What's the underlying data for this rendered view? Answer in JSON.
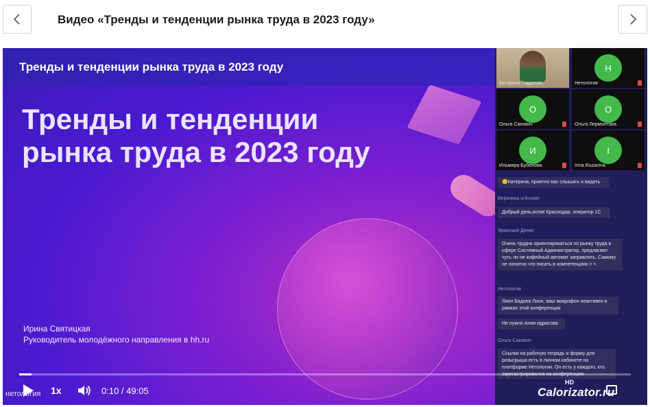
{
  "page": {
    "title": "Видео «Тренды и тенденции рынка труда в 2023 году»"
  },
  "video": {
    "slide_header": "Тренды и тенденции рынка труда в 2023 году",
    "slide_title_line1": "Тренды и тенденции",
    "slide_title_line2": "рынка труда в 2023 году",
    "presenter_name": "Ирина Святицкая",
    "presenter_role": "Руководитель молодёжного направления в hh.ru"
  },
  "participants": [
    {
      "name": "Катерина Гордеева",
      "avatar": ""
    },
    {
      "name": "Нетология",
      "avatar": "Н"
    },
    {
      "name": "Ольга Сакович",
      "avatar": "О"
    },
    {
      "name": "Ольга Лермонтова",
      "avatar": "О"
    },
    {
      "name": "Ильмира Бубенова",
      "avatar": "И"
    },
    {
      "name": "Irina Ruzavina",
      "avatar": "I"
    }
  ],
  "chat": [
    {
      "author": "",
      "text": "😊Катерина, приятно вас слышать и видеть"
    },
    {
      "author": "Вероника unknown",
      "text": "Добрый день,всем! Краснодар, оператор 1С"
    },
    {
      "author": "Яринский Денис",
      "text": "Очень трудно ориентироваться по рынку труда в сфере Системный Администратор, предлагают чуть ли не кофейный автомат заправлять. Самому не понятно что писать в компетенциях > <"
    },
    {
      "author": "Нетология",
      "text": "Лион Бадоев Лион, ваш микрофон неактивен в рамках этой конференции"
    },
    {
      "author": "",
      "text": "Не нужно Алия идрисова"
    },
    {
      "author": "Ольга Сакович",
      "text": "Ссылки на рабочую тетрадь и форму для розыгрыша есть в личном кабинете на платформе Нетологии. Он есть у каждого, кто зарегистрировался на конференцию"
    }
  ],
  "player": {
    "progress": 0.0034,
    "speed": "1x",
    "time": "0:10 / 49:05",
    "hd": "HD"
  },
  "watermarks": {
    "left": "нетология",
    "right": "Calorizator.ru"
  },
  "icons": {
    "prev": "chevron-left-icon",
    "next": "chevron-right-icon",
    "play": "play-icon",
    "volume": "volume-icon",
    "fullscreen": "fullscreen-icon"
  }
}
